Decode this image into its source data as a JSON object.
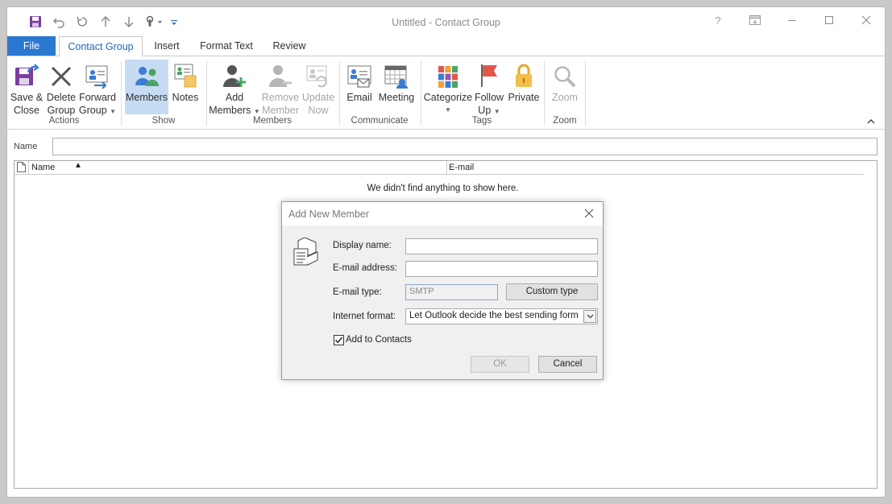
{
  "window": {
    "title": "Untitled - Contact Group",
    "controls": [
      "?",
      "ribbon-display-options",
      "minimize",
      "maximize",
      "close"
    ]
  },
  "quick_access": {
    "icons": [
      "save-icon",
      "undo-icon",
      "redo-icon",
      "up-arrow-icon",
      "down-arrow-icon",
      "touch-mode-icon",
      "customize-qat-icon"
    ]
  },
  "tabs": [
    {
      "label": "File"
    },
    {
      "label": "Contact Group",
      "active": true
    },
    {
      "label": "Insert"
    },
    {
      "label": "Format Text"
    },
    {
      "label": "Review"
    }
  ],
  "ribbon": {
    "groups": {
      "actions": "Actions",
      "show": "Show",
      "members": "Members",
      "communicate": "Communicate",
      "tags": "Tags",
      "zoom": "Zoom"
    },
    "buttons": {
      "save_close": [
        "Save &",
        "Close"
      ],
      "delete_group": [
        "Delete",
        "Group"
      ],
      "forward_group": [
        "Forward",
        "Group"
      ],
      "members": "Members",
      "notes": "Notes",
      "add_members": [
        "Add",
        "Members"
      ],
      "remove_member": [
        "Remove",
        "Member"
      ],
      "update_now": [
        "Update",
        "Now"
      ],
      "email": "Email",
      "meeting": "Meeting",
      "categorize": "Categorize",
      "follow_up": [
        "Follow",
        "Up"
      ],
      "private": "Private",
      "zoom": "Zoom"
    },
    "colors": {
      "file_tab": "#2b78d0",
      "active_tab_text": "#2169b8",
      "selected_button": "#c5dcf2"
    }
  },
  "form": {
    "name_label": "Name",
    "name_value": ""
  },
  "list": {
    "columns": [
      "Name",
      "E-mail"
    ],
    "sort_indicator": "▲",
    "empty_message": "We didn't find anything to show here."
  },
  "dialog": {
    "title": "Add New Member",
    "display_name_label": "Display name:",
    "display_name_value": "",
    "email_address_label": "E-mail address:",
    "email_address_value": "",
    "email_type_label": "E-mail type:",
    "email_type_value": "SMTP",
    "custom_type_button": "Custom type",
    "internet_format_label": "Internet format:",
    "internet_format_value": "Let Outlook decide the best sending form",
    "add_to_contacts_label": "Add to Contacts",
    "add_to_contacts_checked": true,
    "ok_button": "OK",
    "cancel_button": "Cancel"
  }
}
